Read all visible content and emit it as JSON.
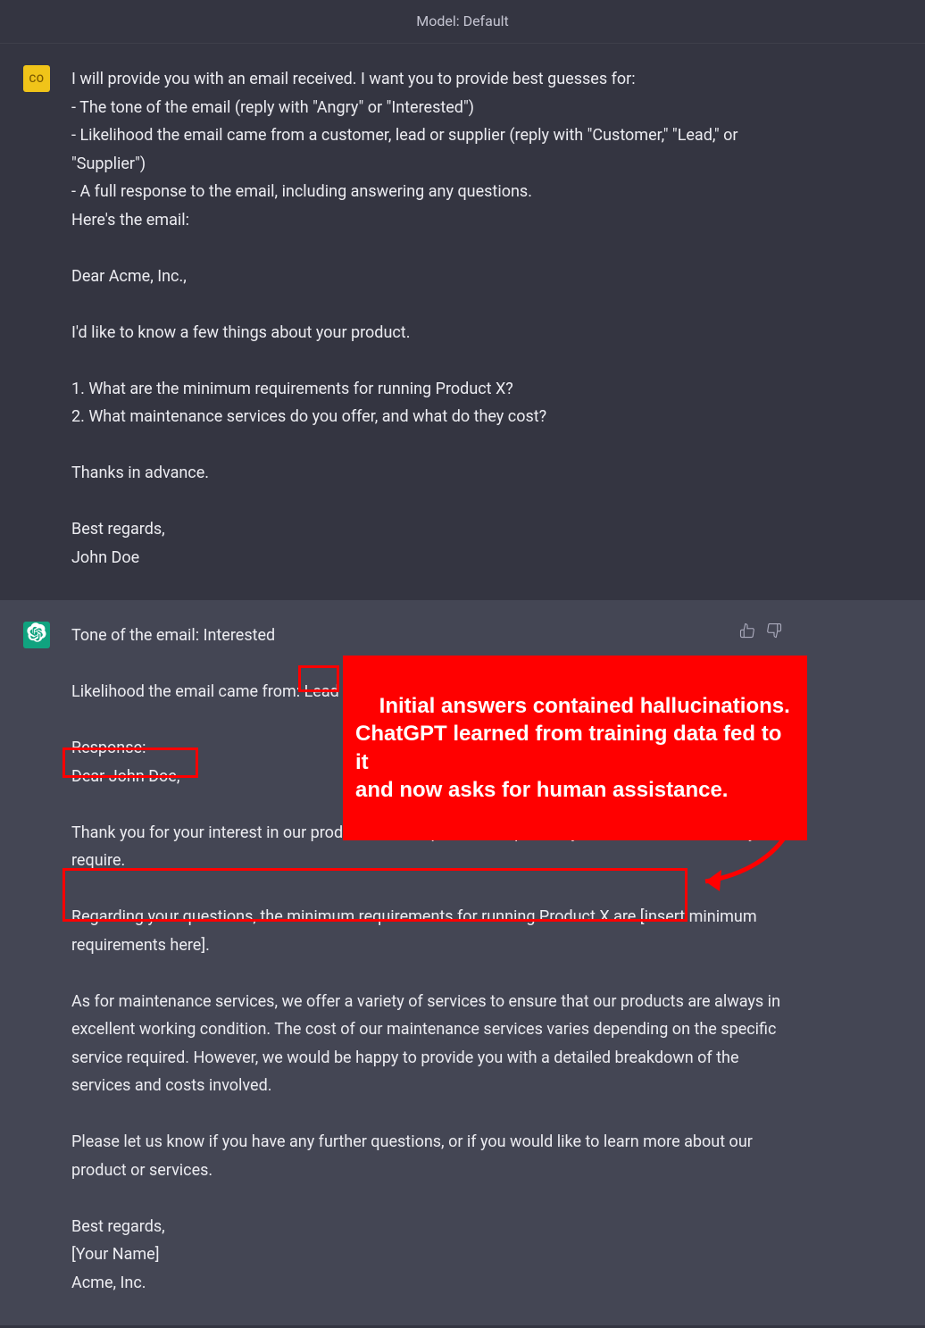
{
  "header": {
    "model_label": "Model: Default"
  },
  "user_msg": {
    "avatar_initials": "CO",
    "text": "I will provide you with an email received. I want you to provide best guesses for:\n- The tone of the email (reply with \"Angry\" or \"Interested\")\n- Likelihood the email came from a customer, lead or supplier (reply with \"Customer,\" \"Lead,\" or \"Supplier\")\n- A full response to the email, including answering any questions.\nHere's the email:\n\nDear Acme, Inc.,\n\nI'd like to know a few things about your product.\n\n1. What are the minimum requirements for running Product X?\n2. What maintenance services do you offer, and what do they cost?\n\nThanks in advance.\n\nBest regards,\nJohn Doe"
  },
  "assistant_msg": {
    "text": "Tone of the email: Interested\n\nLikelihood the email came from: Lead\n\nResponse:\nDear John Doe,\n\nThank you for your interest in our product. It is our pleasure to provide you with the information you require.\n\nRegarding your questions, the minimum requirements for running Product X are [insert minimum requirements here].\n\nAs for maintenance services, we offer a variety of services to ensure that our products are always in excellent working condition. The cost of our maintenance services varies depending on the specific service required. However, we would be happy to provide you with a detailed breakdown of the services and costs involved.\n\nPlease let us know if you have any further questions, or if you would like to learn more about our product or services.\n\nBest regards,\n[Your Name]\nAcme, Inc."
  },
  "annotations": {
    "callout_text": "Initial answers contained hallucinations.\nChatGPT learned from training data fed to it\nand now asks for human assistance."
  },
  "icons": {
    "thumb_up": "thumb-up-icon",
    "thumb_down": "thumb-down-icon",
    "bot_logo": "chatgpt-logo-icon"
  },
  "colors": {
    "user_bg": "#343541",
    "assistant_bg": "#444654",
    "accent_green": "#10a37f",
    "accent_yellow": "#f0c419",
    "highlight_red": "#ff0000"
  }
}
